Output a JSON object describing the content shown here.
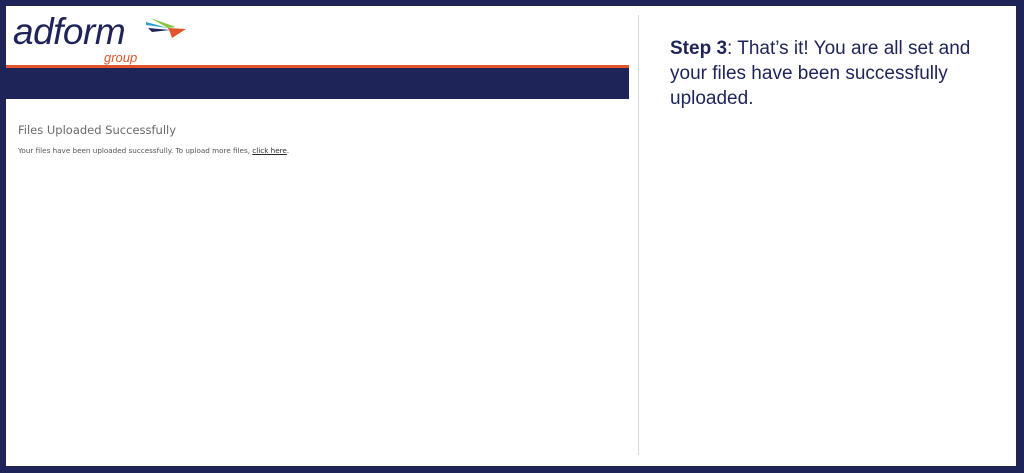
{
  "brand": {
    "logo_word": "adform",
    "logo_sub": "group",
    "colors": {
      "navy": "#1e2458",
      "orange": "#e2552b",
      "teal": "#2a9fc9",
      "green": "#8ac33f"
    }
  },
  "upload_page": {
    "title": "Files Uploaded Successfully",
    "message": "Your files have been uploaded successfully. To upload more files,",
    "link_text": "click here",
    "link_suffix": "."
  },
  "instruction": {
    "step_label": "Step 3",
    "text": ": That’s it! You are all set and your files have been successfully uploaded."
  }
}
